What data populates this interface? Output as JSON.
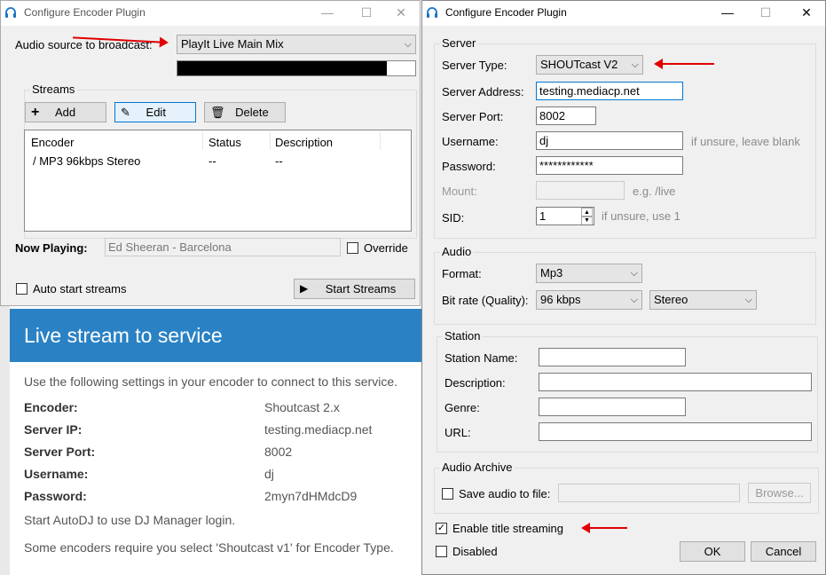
{
  "back_window": {
    "title": "Configure Encoder Plugin",
    "audio_source_label": "Audio source to broadcast:",
    "audio_source_value": "PlayIt Live Main Mix",
    "level_meter_fraction": 0.88,
    "streams_group": "Streams",
    "add_label": "Add",
    "edit_label": "Edit",
    "delete_label": "Delete",
    "columns": [
      "Encoder",
      "Status",
      "Description"
    ],
    "row": {
      "encoder": "/ MP3 96kbps Stereo",
      "status": "--",
      "description": "--"
    },
    "now_playing_label": "Now Playing:",
    "now_playing_value": "Ed Sheeran - Barcelona",
    "override_label": "Override",
    "auto_start_label": "Auto start streams",
    "start_streams_label": "Start Streams"
  },
  "web_page": {
    "header": "Live stream to service",
    "intro": "Use the following settings in your encoder to connect to this service.",
    "rows": [
      {
        "label": "Encoder:",
        "value": "Shoutcast 2.x"
      },
      {
        "label": "Server IP:",
        "value": "testing.mediacp.net"
      },
      {
        "label": "Server Port:",
        "value": "8002"
      },
      {
        "label": "Username:",
        "value": "dj"
      },
      {
        "label": "Password:",
        "value": "2myn7dHMdcD9"
      }
    ],
    "note1": "Start AutoDJ to use DJ Manager login.",
    "note2": "Some encoders require you select 'Shoutcast v1' for Encoder Type.",
    "header_color": "#2a82c4"
  },
  "front_window": {
    "title": "Configure Encoder Plugin",
    "server_group": "Server",
    "server_type_label": "Server Type:",
    "server_type_value": "SHOUTcast V2",
    "server_address_label": "Server Address:",
    "server_address_value": "testing.mediacp.net",
    "server_port_label": "Server Port:",
    "server_port_value": "8002",
    "username_label": "Username:",
    "username_value": "dj",
    "username_hint": "if unsure, leave blank",
    "password_label": "Password:",
    "password_value": "************",
    "mount_label": "Mount:",
    "mount_hint": "e.g. /live",
    "sid_label": "SID:",
    "sid_value": "1",
    "sid_hint": "if unsure, use 1",
    "audio_group": "Audio",
    "format_label": "Format:",
    "format_value": "Mp3",
    "bitrate_label": "Bit rate (Quality):",
    "bitrate_value": "96 kbps",
    "channels_value": "Stereo",
    "station_group": "Station",
    "station_name_label": "Station Name:",
    "description_label": "Description:",
    "genre_label": "Genre:",
    "url_label": "URL:",
    "archive_group": "Audio Archive",
    "save_audio_label": "Save audio to file:",
    "browse_label": "Browse...",
    "enable_title_label": "Enable title streaming",
    "disabled_label": "Disabled",
    "ok_label": "OK",
    "cancel_label": "Cancel"
  }
}
